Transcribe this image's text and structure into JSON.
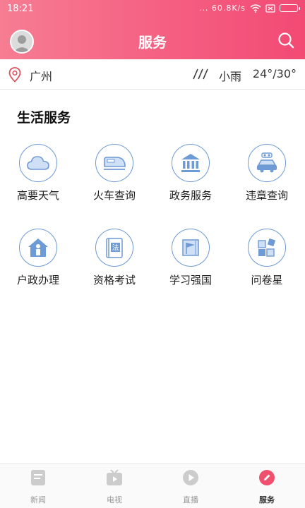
{
  "status_bar": {
    "time": "18:21",
    "network": "... 60.8K/s",
    "icons": [
      "wifi-icon",
      "sim-icon",
      "battery-icon"
    ]
  },
  "header": {
    "title": "服务",
    "avatar": "avatar",
    "search_icon": "search-icon",
    "gradient": [
      "#f67d93",
      "#f24a74"
    ]
  },
  "weather": {
    "city": "广州",
    "condition": "小雨",
    "temperature": "24°/30°"
  },
  "section": {
    "title": "生活服务"
  },
  "services": [
    {
      "label": "高要天气",
      "icon": "cloud-icon"
    },
    {
      "label": "火车查询",
      "icon": "train-icon"
    },
    {
      "label": "政务服务",
      "icon": "government-building-icon"
    },
    {
      "label": "违章查询",
      "icon": "car-violation-icon"
    },
    {
      "label": "户政办理",
      "icon": "household-icon"
    },
    {
      "label": "资格考试",
      "icon": "law-book-icon"
    },
    {
      "label": "学习强国",
      "icon": "study-flag-icon"
    },
    {
      "label": "问卷星",
      "icon": "survey-blocks-icon"
    }
  ],
  "tabs": [
    {
      "label": "新闻",
      "icon": "news-icon",
      "active": false
    },
    {
      "label": "电视",
      "icon": "tv-icon",
      "active": false
    },
    {
      "label": "直播",
      "icon": "play-icon",
      "active": false
    },
    {
      "label": "服务",
      "icon": "service-pen-icon",
      "active": true
    }
  ],
  "colors": {
    "accent": "#f55f82",
    "icon_outline": "#6e9ad6",
    "tab_active": "#f0506e"
  }
}
